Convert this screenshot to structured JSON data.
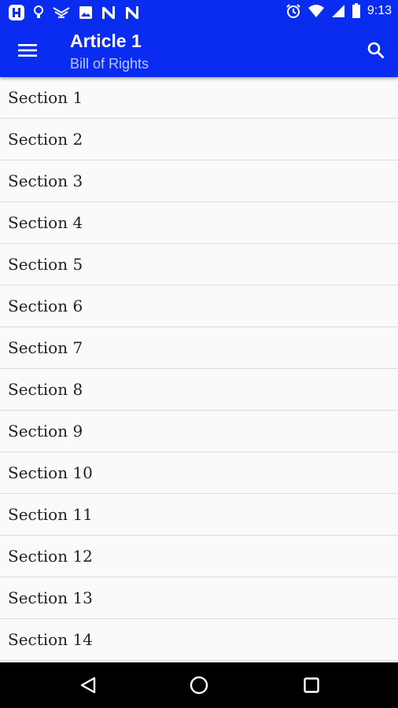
{
  "status_bar": {
    "time": "9:13",
    "left_icons": [
      "h-app-icon",
      "lightbulb-icon",
      "antenna-icon",
      "image-icon",
      "n-app-icon",
      "n-app-icon"
    ],
    "right_icons": [
      "alarm-icon",
      "wifi-icon",
      "signal-icon",
      "battery-icon"
    ]
  },
  "app_bar": {
    "title": "Article 1",
    "subtitle": "Bill of Rights",
    "menu_icon": "hamburger-menu-icon",
    "search_icon": "search-icon",
    "color": "#0a2cf0"
  },
  "sections": [
    {
      "label": "Section 1"
    },
    {
      "label": "Section 2"
    },
    {
      "label": "Section 3"
    },
    {
      "label": "Section 4"
    },
    {
      "label": "Section 5"
    },
    {
      "label": "Section 6"
    },
    {
      "label": "Section 7"
    },
    {
      "label": "Section 8"
    },
    {
      "label": "Section 9"
    },
    {
      "label": "Section 10"
    },
    {
      "label": "Section 11"
    },
    {
      "label": "Section 12"
    },
    {
      "label": "Section 13"
    },
    {
      "label": "Section 14"
    }
  ],
  "nav_bar": {
    "back_icon": "back-triangle-icon",
    "home_icon": "home-circle-icon",
    "recents_icon": "recents-square-icon"
  }
}
